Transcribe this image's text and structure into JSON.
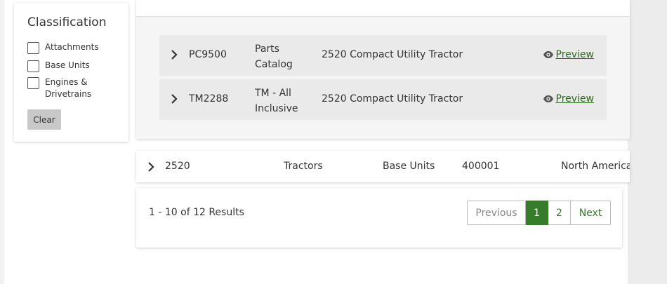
{
  "filter": {
    "title": "Classification",
    "options": [
      "Attachments",
      "Base Units",
      "Engines &\nDrivetrains"
    ],
    "clear_label": "Clear"
  },
  "documents": [
    {
      "code": "PC9500",
      "type": "Parts\nCatalog",
      "model": "2520 Compact Utility Tractor",
      "action": "Preview"
    },
    {
      "code": "TM2288",
      "type": "TM - All\nInclusive",
      "model": "2520 Compact Utility Tractor",
      "action": "Preview"
    }
  ],
  "product": {
    "model": "2520",
    "category": "Tractors",
    "classification": "Base Units",
    "serial": "400001",
    "region": "North America"
  },
  "pagination": {
    "results": "1 - 10 of 12 Results",
    "previous": "Previous",
    "pages": [
      "1",
      "2"
    ],
    "current": "1",
    "next": "Next"
  },
  "colors": {
    "accent": "#367c2b",
    "link": "#2e6b1e"
  }
}
